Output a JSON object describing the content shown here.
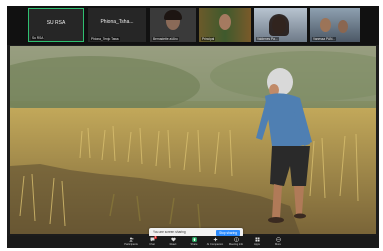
{
  "participants": [
    {
      "display_name": "SU RSA",
      "label": "Su RSA"
    },
    {
      "display_name": "Phiona_Tsha...",
      "label": "Phiona_Tenjo Tawa"
    },
    {
      "label": "Bernadette a/Aho"
    },
    {
      "label": "Principal"
    },
    {
      "label": "Valdenes Pa..."
    },
    {
      "label": "Vanessa PAN..."
    }
  ],
  "share_notice": {
    "text": "You are screen sharing",
    "stop_button": "Stop sharing"
  },
  "toolbar": {
    "items": [
      {
        "label": "Participants",
        "icon": "people-icon"
      },
      {
        "label": "Chat",
        "icon": "chat-icon",
        "badge": "2"
      },
      {
        "label": "React",
        "icon": "heart-icon"
      },
      {
        "label": "Share",
        "icon": "share-icon"
      },
      {
        "label": "AI Companion",
        "icon": "sparkle-icon"
      },
      {
        "label": "Meeting info",
        "icon": "info-icon"
      },
      {
        "label": "Apps",
        "icon": "apps-icon"
      },
      {
        "label": "More",
        "icon": "more-icon"
      }
    ]
  },
  "colors": {
    "active_speaker_border": "#2fbf71",
    "stop_button": "#2d8cff"
  }
}
